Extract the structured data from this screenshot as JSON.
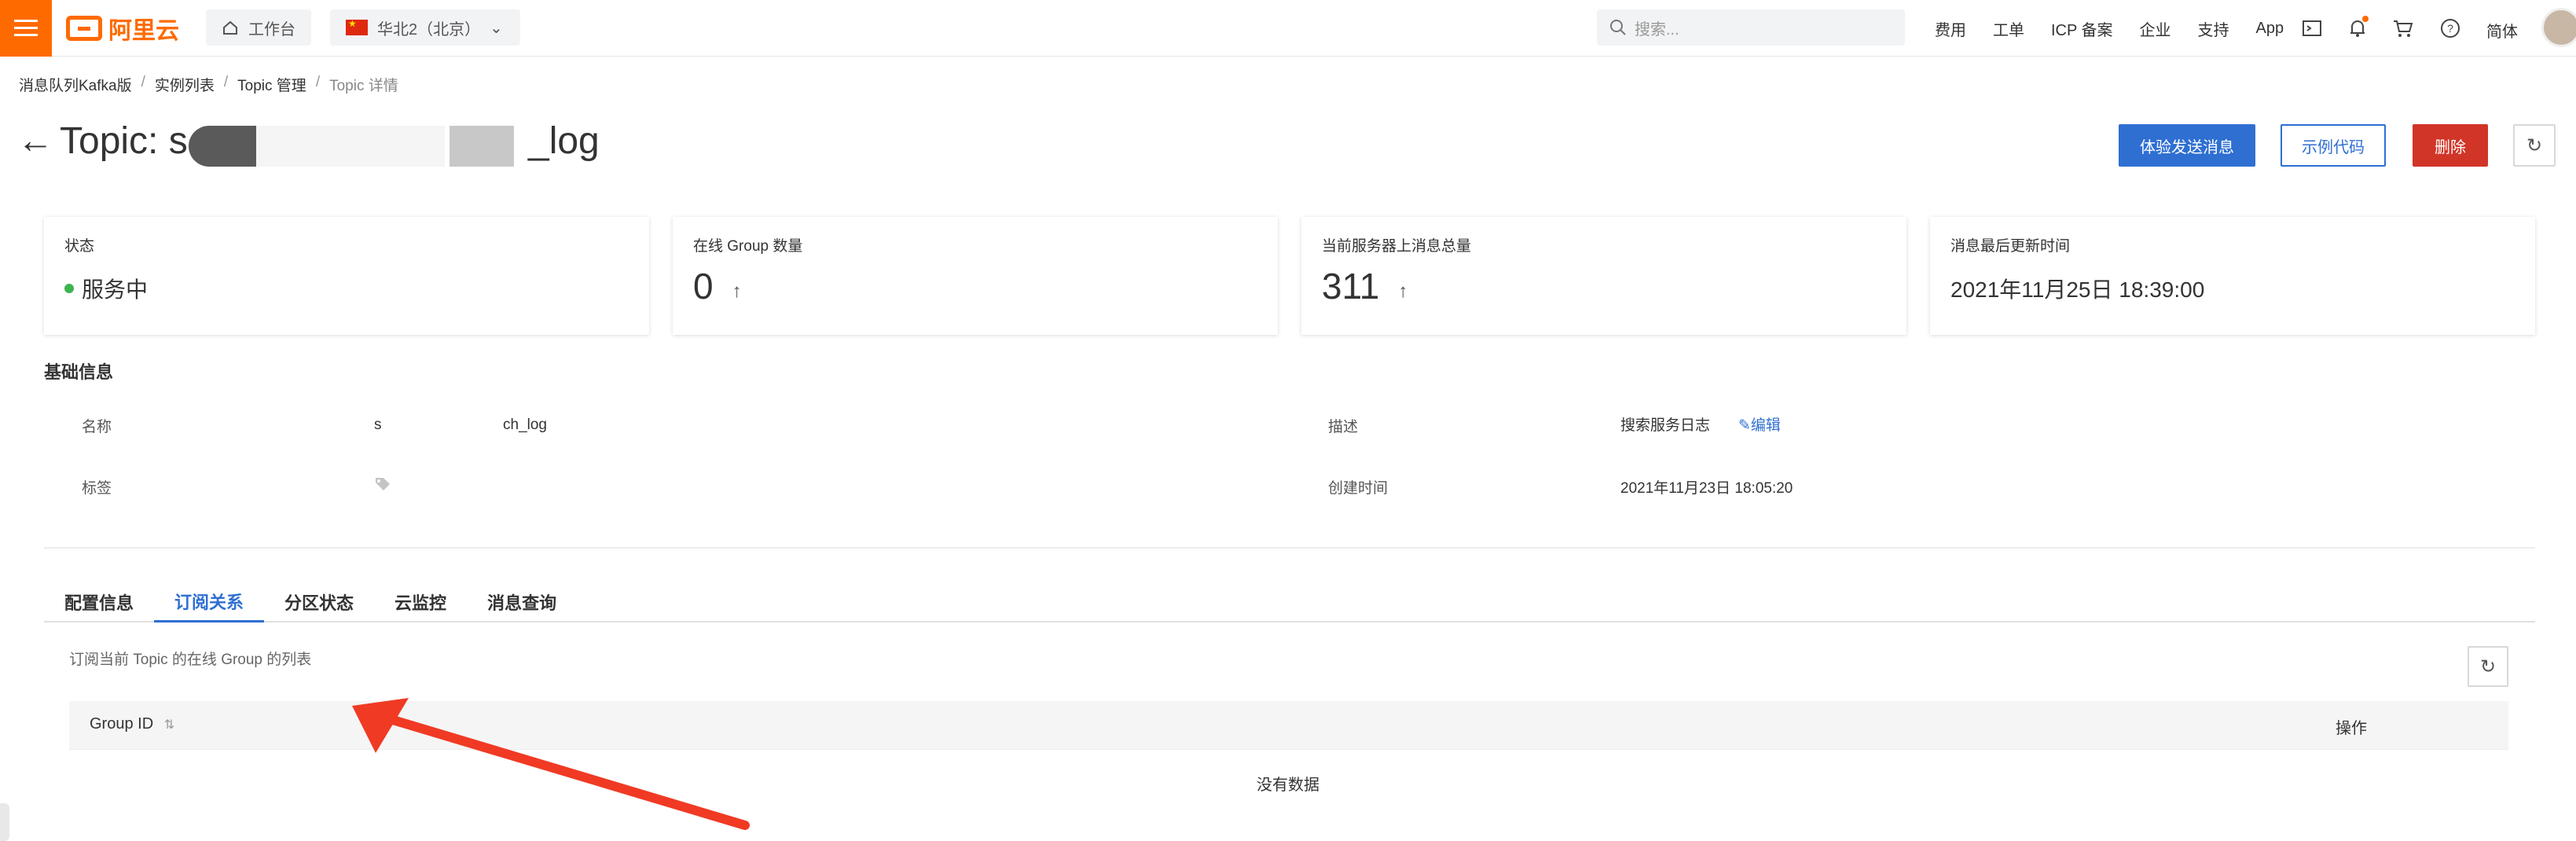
{
  "topbar": {
    "logo_text": "阿里云",
    "workbench_label": "工作台",
    "region_label": "华北2（北京）",
    "search_placeholder": "搜索...",
    "nav_links": [
      "费用",
      "工单",
      "ICP 备案",
      "企业",
      "支持",
      "App"
    ],
    "lang_label": "简体"
  },
  "breadcrumb": [
    "消息队列Kafka版",
    "实例列表",
    "Topic 管理",
    "Topic 详情"
  ],
  "page": {
    "title_prefix": "Topic: s",
    "title_suffix": "_log",
    "buttons": {
      "send": "体验发送消息",
      "sample": "示例代码",
      "delete": "删除"
    }
  },
  "stats": [
    {
      "label": "状态",
      "value": "服务中"
    },
    {
      "label": "在线 Group 数量",
      "value": "0"
    },
    {
      "label": "当前服务器上消息总量",
      "value": "311"
    },
    {
      "label": "消息最后更新时间",
      "value": "2021年11月25日 18:39:00"
    }
  ],
  "basic_info": {
    "title": "基础信息",
    "name_label": "名称",
    "name_value_start": "s",
    "name_value_end": "ch_log",
    "tag_label": "标签",
    "desc_label": "描述",
    "desc_value": "搜索服务日志",
    "edit_label": "编辑",
    "created_label": "创建时间",
    "created_value": "2021年11月23日 18:05:20"
  },
  "tabs": [
    "配置信息",
    "订阅关系",
    "分区状态",
    "云监控",
    "消息查询"
  ],
  "active_tab": "订阅关系",
  "subscription": {
    "description": "订阅当前 Topic 的在线 Group 的列表",
    "columns": {
      "group_id": "Group ID",
      "actions": "操作"
    },
    "empty_text": "没有数据"
  },
  "colors": {
    "brand": "#ff6a00",
    "primary": "#2f6fd2",
    "danger": "#d13528",
    "status_ok": "#3eb34f",
    "annotation_arrow": "#f03a24"
  }
}
